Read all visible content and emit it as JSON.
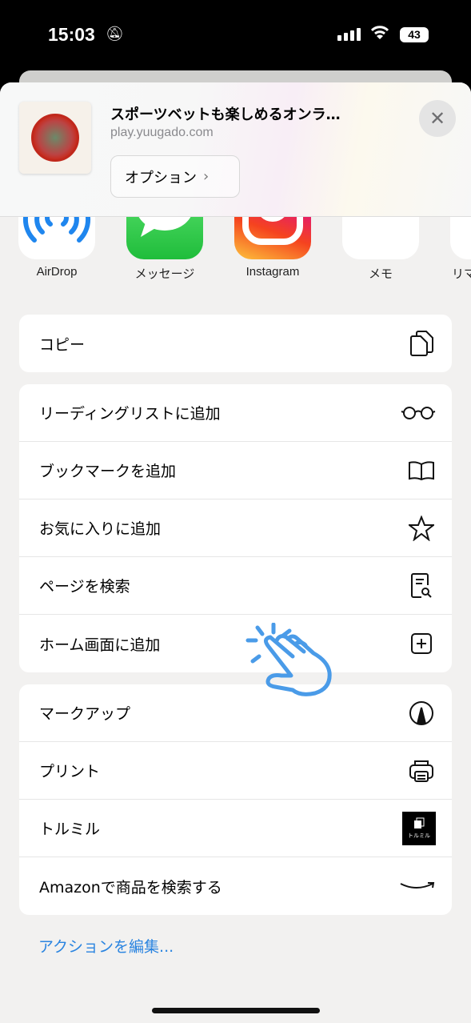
{
  "status": {
    "time": "15:03",
    "battery": "43",
    "silent_icon": "bell-slash-icon"
  },
  "header": {
    "title": "スポーツベットも楽しめるオンラ…",
    "url": "play.yuugado.com",
    "options_label": "オプション",
    "options_chevron": "›",
    "close": "✕"
  },
  "apps": [
    {
      "label": "AirDrop",
      "icon": "airdrop-icon"
    },
    {
      "label": "メッセージ",
      "icon": "messages-icon"
    },
    {
      "label": "Instagram",
      "icon": "instagram-icon"
    },
    {
      "label": "メモ",
      "icon": "notes-icon"
    },
    {
      "label": "リマ",
      "icon": "reminders-icon"
    }
  ],
  "groups": [
    [
      {
        "label": "コピー",
        "icon": "copy-icon"
      }
    ],
    [
      {
        "label": "リーディングリストに追加",
        "icon": "glasses-icon"
      },
      {
        "label": "ブックマークを追加",
        "icon": "book-icon"
      },
      {
        "label": "お気に入りに追加",
        "icon": "star-icon"
      },
      {
        "label": "ページを検索",
        "icon": "find-in-page-icon"
      },
      {
        "label": "ホーム画面に追加",
        "icon": "add-square-icon"
      }
    ],
    [
      {
        "label": "マークアップ",
        "icon": "markup-icon"
      },
      {
        "label": "プリント",
        "icon": "printer-icon"
      },
      {
        "label": "トルミル",
        "icon": "torumiru-app-icon",
        "app_text": "トルミル"
      },
      {
        "label": "Amazonで商品を検索する",
        "icon": "amazon-smile-icon"
      }
    ]
  ],
  "edit_actions": "アクションを編集...",
  "colors": {
    "accent": "#2a84e0",
    "airdrop": "#1f86ee",
    "messages": "#34c759"
  }
}
